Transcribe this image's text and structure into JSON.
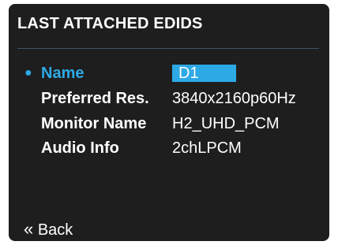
{
  "header": {
    "title": "LAST ATTACHED EDIDS"
  },
  "fields": [
    {
      "label": "Name",
      "value": "D1",
      "selected": true
    },
    {
      "label": "Preferred Res.",
      "value": "3840x2160p60Hz",
      "selected": false
    },
    {
      "label": "Monitor Name",
      "value": "H2_UHD_PCM",
      "selected": false
    },
    {
      "label": "Audio Info",
      "value": "2chLPCM",
      "selected": false
    }
  ],
  "footer": {
    "back_icon": "«",
    "back_label": "Back"
  },
  "colors": {
    "background": "#1e1e1e",
    "accent": "#2da9e6",
    "text": "#ffffff",
    "divider": "#3e5460"
  },
  "icons": {
    "bullet": "selection-bullet-icon",
    "back": "double-chevron-left-icon"
  }
}
